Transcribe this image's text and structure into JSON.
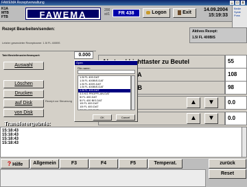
{
  "window": {
    "title": "FAWEMA Rezeptverwaltung",
    "controls": [
      "_",
      "□",
      "x"
    ]
  },
  "header": {
    "ids": [
      "K1A",
      "MTB",
      "FTB"
    ],
    "logo": "FAWEMA",
    "counter_top": "200",
    "counter_bottom": "st/1",
    "machine": "FR 438",
    "logon_label": "Logon",
    "exit_label": "Exit",
    "date": "14.09.2004",
    "time": "15:19:33"
  },
  "sidebar": {
    "lines": [
      "Bedie",
      "Syste",
      "Poss"
    ]
  },
  "recipe": {
    "heading": "Rezept Bearbeiten/senden:",
    "last_recipe_line": "Letzter gesendeter Rezeptname:   1.5l FL 400BS",
    "active_label": "Aktives Rezept:",
    "active_value": "1.5l FL 400BIS"
  },
  "transport": {
    "label": "Takt Bestellmuster/transport:",
    "value": "0.000"
  },
  "left_buttons": {
    "select": "Auswahl",
    "delete": "Löschen",
    "print": "Drucken",
    "to_disk": "auf Disk",
    "from_disk": "von Disk"
  },
  "side_note": "Rezept zur Steuerung",
  "params": [
    {
      "label": "Abstand Lichttaster zu Beutel",
      "value": "55"
    },
    {
      "label": "u Maschine A",
      "value": "108"
    },
    {
      "label": "u Maschine B",
      "value": "98"
    },
    {
      "label": "ozug vorne",
      "value": "0.0"
    },
    {
      "label": "ozug hinten",
      "value": "0.0"
    }
  ],
  "arrows": {
    "up": "▲",
    "down": "▼"
  },
  "dialog": {
    "title": "Open",
    "file_label": "File name:",
    "files": [
      "1.5l FL 400.DAT",
      "1.5l FL 400BIS.DAT",
      "1.5l FL 400S.DAT",
      "1.5l FL 400BIS.DAT",
      "1.5l FL 400.DAT",
      "3.5 KG PROPFLAN.DAT",
      "5l FL 400.DAT",
      "5l FL 400 BIS.DAT",
      "10l FL 400.DAT",
      "10l FL 400.DAT",
      "20l FL 400.DAT",
      "25l FL 400.DAT",
      "30 FL 400.DAT",
      "3l FL ACP.DAT"
    ],
    "selected_index": 4,
    "ok": "OK",
    "cancel": "Cancel"
  },
  "transfer": {
    "heading": "Transferergebnis:",
    "log": [
      "15:18:43",
      "15:18:43",
      "15:18:43",
      "15:18:43"
    ]
  },
  "footer": {
    "help": "Hilfe",
    "help_icon": "?",
    "buttons": [
      "Allgemein",
      "F3",
      "F4",
      "F5",
      "Temperat."
    ],
    "back": "zurück",
    "reset": "Reset"
  },
  "colors": {
    "logo_bg": "#000066",
    "machine_bg": "#0000aa",
    "help_icon": "#cc0000",
    "transfer_heading": "#ffffff"
  }
}
